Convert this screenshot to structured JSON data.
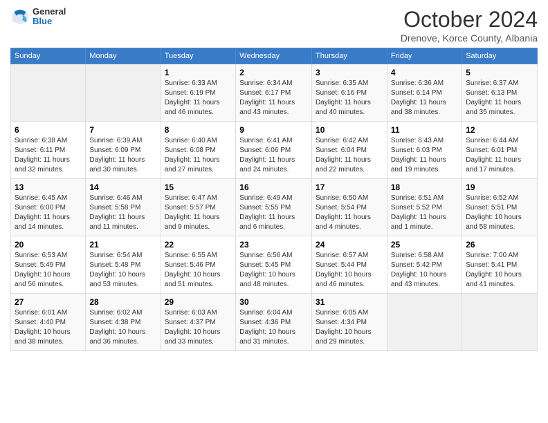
{
  "logo": {
    "general": "General",
    "blue": "Blue"
  },
  "header": {
    "month": "October 2024",
    "location": "Drenove, Korce County, Albania"
  },
  "weekdays": [
    "Sunday",
    "Monday",
    "Tuesday",
    "Wednesday",
    "Thursday",
    "Friday",
    "Saturday"
  ],
  "weeks": [
    [
      {
        "day": "",
        "sunrise": "",
        "sunset": "",
        "daylight": "",
        "empty": true
      },
      {
        "day": "",
        "sunrise": "",
        "sunset": "",
        "daylight": "",
        "empty": true
      },
      {
        "day": "1",
        "sunrise": "Sunrise: 6:33 AM",
        "sunset": "Sunset: 6:19 PM",
        "daylight": "Daylight: 11 hours and 46 minutes.",
        "empty": false
      },
      {
        "day": "2",
        "sunrise": "Sunrise: 6:34 AM",
        "sunset": "Sunset: 6:17 PM",
        "daylight": "Daylight: 11 hours and 43 minutes.",
        "empty": false
      },
      {
        "day": "3",
        "sunrise": "Sunrise: 6:35 AM",
        "sunset": "Sunset: 6:16 PM",
        "daylight": "Daylight: 11 hours and 40 minutes.",
        "empty": false
      },
      {
        "day": "4",
        "sunrise": "Sunrise: 6:36 AM",
        "sunset": "Sunset: 6:14 PM",
        "daylight": "Daylight: 11 hours and 38 minutes.",
        "empty": false
      },
      {
        "day": "5",
        "sunrise": "Sunrise: 6:37 AM",
        "sunset": "Sunset: 6:13 PM",
        "daylight": "Daylight: 11 hours and 35 minutes.",
        "empty": false
      }
    ],
    [
      {
        "day": "6",
        "sunrise": "Sunrise: 6:38 AM",
        "sunset": "Sunset: 6:11 PM",
        "daylight": "Daylight: 11 hours and 32 minutes.",
        "empty": false
      },
      {
        "day": "7",
        "sunrise": "Sunrise: 6:39 AM",
        "sunset": "Sunset: 6:09 PM",
        "daylight": "Daylight: 11 hours and 30 minutes.",
        "empty": false
      },
      {
        "day": "8",
        "sunrise": "Sunrise: 6:40 AM",
        "sunset": "Sunset: 6:08 PM",
        "daylight": "Daylight: 11 hours and 27 minutes.",
        "empty": false
      },
      {
        "day": "9",
        "sunrise": "Sunrise: 6:41 AM",
        "sunset": "Sunset: 6:06 PM",
        "daylight": "Daylight: 11 hours and 24 minutes.",
        "empty": false
      },
      {
        "day": "10",
        "sunrise": "Sunrise: 6:42 AM",
        "sunset": "Sunset: 6:04 PM",
        "daylight": "Daylight: 11 hours and 22 minutes.",
        "empty": false
      },
      {
        "day": "11",
        "sunrise": "Sunrise: 6:43 AM",
        "sunset": "Sunset: 6:03 PM",
        "daylight": "Daylight: 11 hours and 19 minutes.",
        "empty": false
      },
      {
        "day": "12",
        "sunrise": "Sunrise: 6:44 AM",
        "sunset": "Sunset: 6:01 PM",
        "daylight": "Daylight: 11 hours and 17 minutes.",
        "empty": false
      }
    ],
    [
      {
        "day": "13",
        "sunrise": "Sunrise: 6:45 AM",
        "sunset": "Sunset: 6:00 PM",
        "daylight": "Daylight: 11 hours and 14 minutes.",
        "empty": false
      },
      {
        "day": "14",
        "sunrise": "Sunrise: 6:46 AM",
        "sunset": "Sunset: 5:58 PM",
        "daylight": "Daylight: 11 hours and 11 minutes.",
        "empty": false
      },
      {
        "day": "15",
        "sunrise": "Sunrise: 6:47 AM",
        "sunset": "Sunset: 5:57 PM",
        "daylight": "Daylight: 11 hours and 9 minutes.",
        "empty": false
      },
      {
        "day": "16",
        "sunrise": "Sunrise: 6:49 AM",
        "sunset": "Sunset: 5:55 PM",
        "daylight": "Daylight: 11 hours and 6 minutes.",
        "empty": false
      },
      {
        "day": "17",
        "sunrise": "Sunrise: 6:50 AM",
        "sunset": "Sunset: 5:54 PM",
        "daylight": "Daylight: 11 hours and 4 minutes.",
        "empty": false
      },
      {
        "day": "18",
        "sunrise": "Sunrise: 6:51 AM",
        "sunset": "Sunset: 5:52 PM",
        "daylight": "Daylight: 11 hours and 1 minute.",
        "empty": false
      },
      {
        "day": "19",
        "sunrise": "Sunrise: 6:52 AM",
        "sunset": "Sunset: 5:51 PM",
        "daylight": "Daylight: 10 hours and 58 minutes.",
        "empty": false
      }
    ],
    [
      {
        "day": "20",
        "sunrise": "Sunrise: 6:53 AM",
        "sunset": "Sunset: 5:49 PM",
        "daylight": "Daylight: 10 hours and 56 minutes.",
        "empty": false
      },
      {
        "day": "21",
        "sunrise": "Sunrise: 6:54 AM",
        "sunset": "Sunset: 5:48 PM",
        "daylight": "Daylight: 10 hours and 53 minutes.",
        "empty": false
      },
      {
        "day": "22",
        "sunrise": "Sunrise: 6:55 AM",
        "sunset": "Sunset: 5:46 PM",
        "daylight": "Daylight: 10 hours and 51 minutes.",
        "empty": false
      },
      {
        "day": "23",
        "sunrise": "Sunrise: 6:56 AM",
        "sunset": "Sunset: 5:45 PM",
        "daylight": "Daylight: 10 hours and 48 minutes.",
        "empty": false
      },
      {
        "day": "24",
        "sunrise": "Sunrise: 6:57 AM",
        "sunset": "Sunset: 5:44 PM",
        "daylight": "Daylight: 10 hours and 46 minutes.",
        "empty": false
      },
      {
        "day": "25",
        "sunrise": "Sunrise: 6:58 AM",
        "sunset": "Sunset: 5:42 PM",
        "daylight": "Daylight: 10 hours and 43 minutes.",
        "empty": false
      },
      {
        "day": "26",
        "sunrise": "Sunrise: 7:00 AM",
        "sunset": "Sunset: 5:41 PM",
        "daylight": "Daylight: 10 hours and 41 minutes.",
        "empty": false
      }
    ],
    [
      {
        "day": "27",
        "sunrise": "Sunrise: 6:01 AM",
        "sunset": "Sunset: 4:40 PM",
        "daylight": "Daylight: 10 hours and 38 minutes.",
        "empty": false
      },
      {
        "day": "28",
        "sunrise": "Sunrise: 6:02 AM",
        "sunset": "Sunset: 4:38 PM",
        "daylight": "Daylight: 10 hours and 36 minutes.",
        "empty": false
      },
      {
        "day": "29",
        "sunrise": "Sunrise: 6:03 AM",
        "sunset": "Sunset: 4:37 PM",
        "daylight": "Daylight: 10 hours and 33 minutes.",
        "empty": false
      },
      {
        "day": "30",
        "sunrise": "Sunrise: 6:04 AM",
        "sunset": "Sunset: 4:36 PM",
        "daylight": "Daylight: 10 hours and 31 minutes.",
        "empty": false
      },
      {
        "day": "31",
        "sunrise": "Sunrise: 6:05 AM",
        "sunset": "Sunset: 4:34 PM",
        "daylight": "Daylight: 10 hours and 29 minutes.",
        "empty": false
      },
      {
        "day": "",
        "sunrise": "",
        "sunset": "",
        "daylight": "",
        "empty": true
      },
      {
        "day": "",
        "sunrise": "",
        "sunset": "",
        "daylight": "",
        "empty": true
      }
    ]
  ]
}
